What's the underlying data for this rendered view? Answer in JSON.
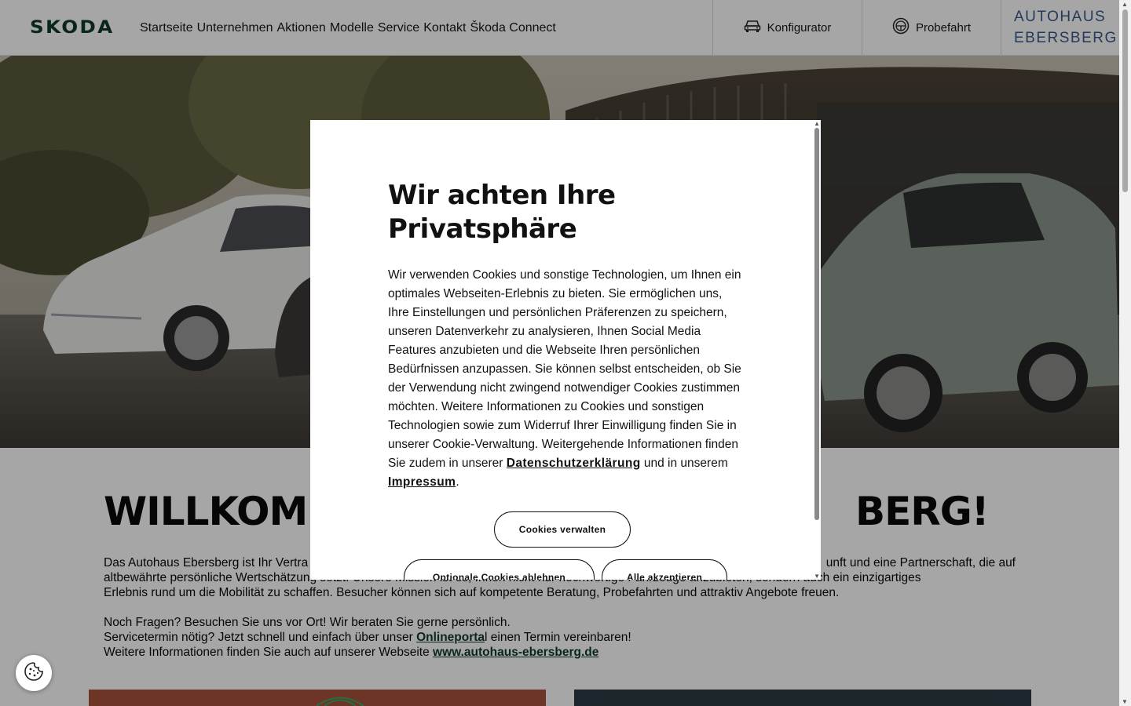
{
  "header": {
    "logo": "SKODA",
    "nav": [
      "Startseite",
      "Unternehmen",
      "Aktionen",
      "Modelle",
      "Service",
      "Kontakt",
      "Škoda Connect"
    ],
    "konfigurator": "Konfigurator",
    "probefahrt": "Probefahrt",
    "dealer_line1": "AUTOHAUS",
    "dealer_line2": "EBERSBERG"
  },
  "content": {
    "welcome_left": "WILLKOMM",
    "welcome_right": "BERG!",
    "intro_visible_left": "Das Autohaus Ebersberg ist Ihr Vertra",
    "intro_visible_right": "unft und eine Partnerschaft, die auf",
    "intro_line2_left": "altbewährte persönliche Wertschätzung setzt. Unsere Mission ist es, Ihnen nicht nur hochwertige Fahrzeuge anzubieten, sondern auch ein einzigartiges",
    "intro_line3": "Erlebnis rund um die Mobilität zu schaffen. Besucher können sich auf kompetente Beratung, Probefahrten und attraktiv Angebote freuen.",
    "questions": "Noch Fragen? Besuchen Sie uns vor Ort! Wir beraten Sie gerne persönlich.",
    "service_before": "Servicetermin nötig? Jetzt schnell und einfach über unser ",
    "service_link": "Onlineporta",
    "service_after": "l einen Termin vereinbaren!",
    "website_before": "Weitere Informationen finden Sie auch auf unserer Webseite ",
    "website_link": "www.autohaus-ebersberg.de"
  },
  "modal": {
    "title": "Wir achten Ihre Privatsphäre",
    "text_1": "Wir verwenden Cookies und sonstige Technologien, um Ihnen ein optimales Webseiten-Erlebnis zu bieten. Sie ermöglichen uns, Ihre Einstellungen und persönlichen Präferenzen zu speichern, unseren Datenverkehr zu analysieren, Ihnen Social Media Features anzubieten und die Webseite Ihren persönlichen Bedürfnissen anzupassen. Sie können selbst entscheiden, ob Sie der Verwendung nicht zwingend notwendiger Cookies zustimmen möchten. Weitere Informationen zu Cookies und sonstigen Technologien sowie zum Widerruf Ihrer Einwilligung finden Sie in unserer Cookie-Verwaltung. Weitergehende Informationen finden Sie zudem in unserer ",
    "link_privacy": "Datenschutzerklärung",
    "text_2": " und in unserem ",
    "link_imprint": "Impressum",
    "text_3": ".",
    "btn_manage": "Cookies verwalten",
    "btn_reject": "Optionale Cookies ablehnen",
    "btn_accept": "Alle akzeptieren"
  },
  "colors": {
    "brand_green": "#0e3a2f",
    "dealer_blue": "#3a5a8a",
    "overlay": "rgba(0,0,0,0.35)"
  },
  "icons": [
    "car-icon",
    "steering-wheel-icon",
    "cookie-icon",
    "scroll-up-arrow-icon",
    "scroll-down-arrow-icon"
  ]
}
